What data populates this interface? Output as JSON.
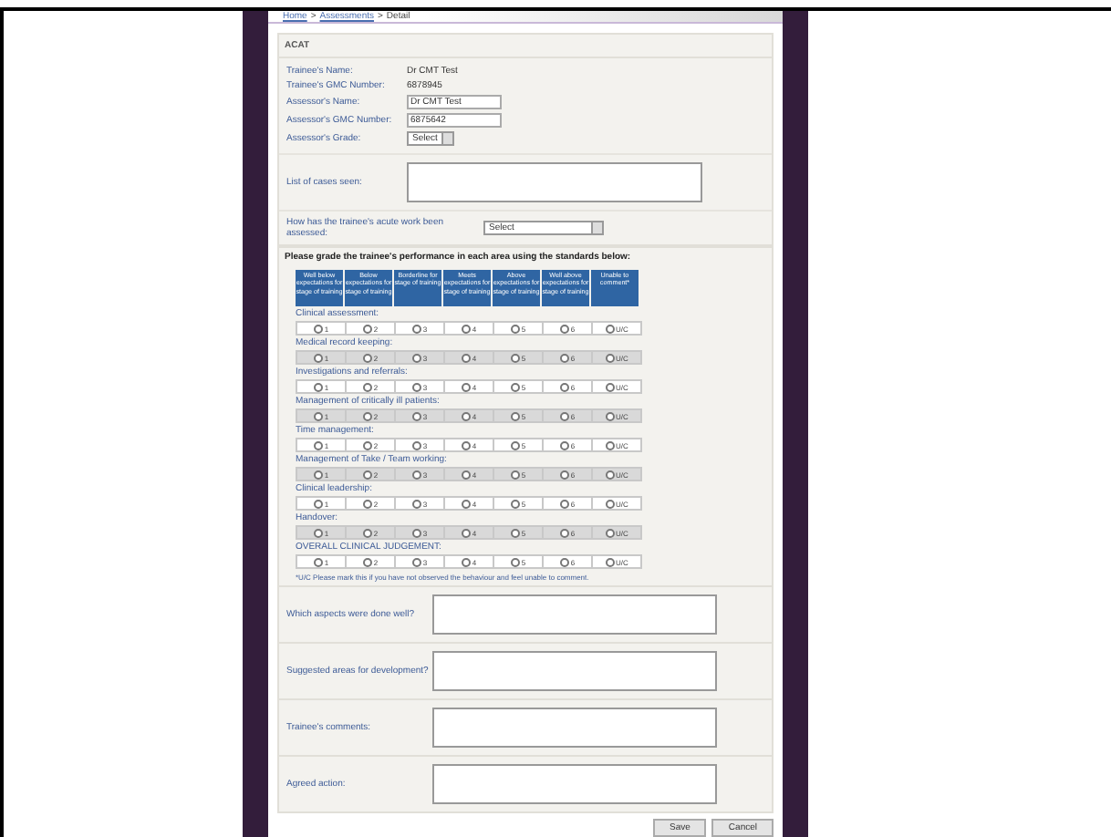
{
  "breadcrumb": [
    {
      "label": "Home",
      "link": true
    },
    {
      "label": ">",
      "link": false
    },
    {
      "label": "Assessments",
      "link": true
    },
    {
      "label": ">",
      "link": false
    },
    {
      "label": "Detail",
      "link": false
    }
  ],
  "form": {
    "title": "ACAT",
    "details": [
      {
        "label": "Trainee's Name:",
        "kind": "text",
        "value": "Dr CMT Test"
      },
      {
        "label": "Trainee's GMC Number:",
        "kind": "text",
        "value": "6878945"
      },
      {
        "label": "Assessor's Name:",
        "kind": "input",
        "value": "Dr CMT Test"
      },
      {
        "label": "Assessor's GMC Number:",
        "kind": "input",
        "value": "6875642"
      },
      {
        "label": "Assessor's Grade:",
        "kind": "select",
        "value": "Select"
      }
    ],
    "cases_label": "List of cases seen:",
    "assessed": {
      "label": "How has the trainee's acute work been assessed:",
      "value": "Select"
    }
  },
  "grading": {
    "instruction": "Please grade the trainee's performance in each area using the standards below:",
    "columns": [
      "Well below expectations for stage of training",
      "Below expectations for stage of training",
      "Borderline for stage of training",
      "Meets expectations for stage of training",
      "Above expectations for stage of training",
      "Well above expectations for stage of training",
      "Unable to comment*"
    ],
    "areas": [
      {
        "name": "Clinical assessment:",
        "options": [
          {
            "label": "1",
            "selected": false
          },
          {
            "label": "2",
            "selected": false
          },
          {
            "label": "3",
            "selected": false
          },
          {
            "label": "4",
            "selected": false
          },
          {
            "label": "5",
            "selected": false
          },
          {
            "label": "6",
            "selected": false
          },
          {
            "label": "U/C",
            "selected": false
          }
        ]
      },
      {
        "name": "Medical record keeping:",
        "options": [
          {
            "label": "1",
            "selected": false
          },
          {
            "label": "2",
            "selected": false
          },
          {
            "label": "3",
            "selected": false
          },
          {
            "label": "4",
            "selected": false
          },
          {
            "label": "5",
            "selected": false
          },
          {
            "label": "6",
            "selected": false
          },
          {
            "label": "U/C",
            "selected": false
          }
        ]
      },
      {
        "name": "Investigations and referrals:",
        "options": [
          {
            "label": "1",
            "selected": false
          },
          {
            "label": "2",
            "selected": false
          },
          {
            "label": "3",
            "selected": false
          },
          {
            "label": "4",
            "selected": false
          },
          {
            "label": "5",
            "selected": false
          },
          {
            "label": "6",
            "selected": false
          },
          {
            "label": "U/C",
            "selected": false
          }
        ]
      },
      {
        "name": "Management of critically ill patients:",
        "options": [
          {
            "label": "1",
            "selected": false
          },
          {
            "label": "2",
            "selected": false
          },
          {
            "label": "3",
            "selected": false
          },
          {
            "label": "4",
            "selected": false
          },
          {
            "label": "5",
            "selected": false
          },
          {
            "label": "6",
            "selected": false
          },
          {
            "label": "U/C",
            "selected": false
          }
        ]
      },
      {
        "name": "Time management:",
        "options": [
          {
            "label": "1",
            "selected": false
          },
          {
            "label": "2",
            "selected": false
          },
          {
            "label": "3",
            "selected": false
          },
          {
            "label": "4",
            "selected": false
          },
          {
            "label": "5",
            "selected": false
          },
          {
            "label": "6",
            "selected": false
          },
          {
            "label": "U/C",
            "selected": false
          }
        ]
      },
      {
        "name": "Management of Take / Team working:",
        "options": [
          {
            "label": "1",
            "selected": false
          },
          {
            "label": "2",
            "selected": false
          },
          {
            "label": "3",
            "selected": false
          },
          {
            "label": "4",
            "selected": false
          },
          {
            "label": "5",
            "selected": false
          },
          {
            "label": "6",
            "selected": false
          },
          {
            "label": "U/C",
            "selected": false
          }
        ]
      },
      {
        "name": "Clinical leadership:",
        "options": [
          {
            "label": "1",
            "selected": false
          },
          {
            "label": "2",
            "selected": false
          },
          {
            "label": "3",
            "selected": false
          },
          {
            "label": "4",
            "selected": false
          },
          {
            "label": "5",
            "selected": false
          },
          {
            "label": "6",
            "selected": false
          },
          {
            "label": "U/C",
            "selected": false
          }
        ]
      },
      {
        "name": "Handover:",
        "options": [
          {
            "label": "1",
            "selected": false
          },
          {
            "label": "2",
            "selected": false
          },
          {
            "label": "3",
            "selected": false
          },
          {
            "label": "4",
            "selected": false
          },
          {
            "label": "5",
            "selected": false
          },
          {
            "label": "6",
            "selected": false
          },
          {
            "label": "U/C",
            "selected": false
          }
        ]
      },
      {
        "name": "OVERALL CLINICAL JUDGEMENT:",
        "options": [
          {
            "label": "1",
            "selected": false
          },
          {
            "label": "2",
            "selected": false
          },
          {
            "label": "3",
            "selected": false
          },
          {
            "label": "4",
            "selected": false
          },
          {
            "label": "5",
            "selected": false
          },
          {
            "label": "6",
            "selected": false
          },
          {
            "label": "U/C",
            "selected": false
          }
        ]
      }
    ],
    "footnote": "*U/C Please mark this if you have not observed the behaviour and feel unable to comment."
  },
  "comments": [
    "Which aspects were done well?",
    "Suggested areas for development?",
    "Trainee's comments:",
    "Agreed action:"
  ],
  "buttons": [
    "Save",
    "Cancel"
  ]
}
